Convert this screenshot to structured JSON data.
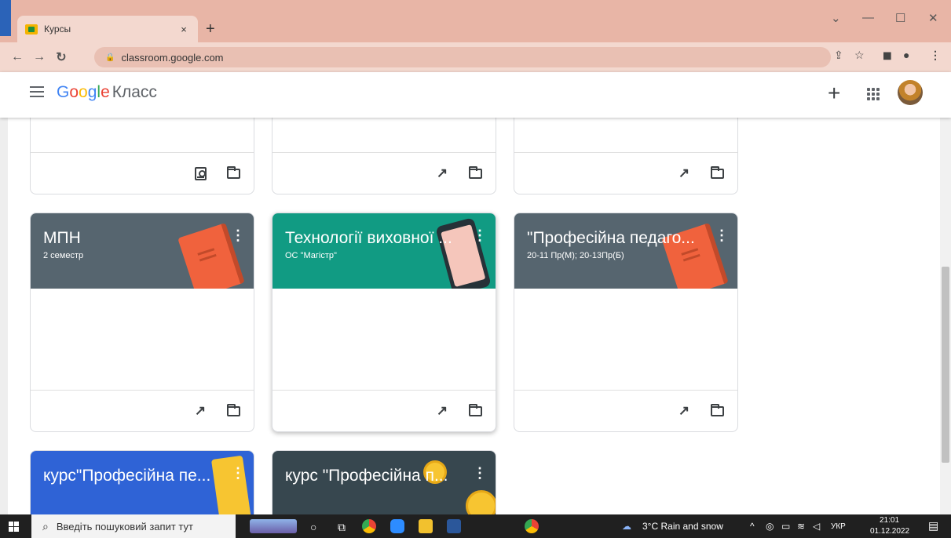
{
  "browser": {
    "tab_title": "Курсы",
    "tab_close": "×",
    "new_tab": "+",
    "url": "classroom.google.com",
    "window_controls": [
      "⌄",
      "—",
      "☐",
      "✕"
    ]
  },
  "app": {
    "logo_google": "Google",
    "logo_product": "Класс"
  },
  "cards": [
    {
      "name": "МПН",
      "section": "2 семестр",
      "color": "#56656f",
      "art": "book"
    },
    {
      "name": "Технології виховної ...",
      "section": "ОС \"Магістр\"",
      "color": "#119b83",
      "art": "phone"
    },
    {
      "name": "\"Професійна педаго...",
      "section": "20-11 Пр(М); 20-13Пр(Б)",
      "color": "#56656f",
      "art": "book"
    },
    {
      "name": "курс\"Професійна пе...",
      "section": "",
      "color": "#2f63d6",
      "art": "blue"
    },
    {
      "name": "курс \"Професійна п...",
      "section": "",
      "color": "#37474f",
      "art": "coin"
    }
  ],
  "taskbar": {
    "search_placeholder": "Введіть пошуковий запит тут",
    "weather": "3°C  Rain and snow",
    "lang": "УКР",
    "time": "21:01",
    "date": "01.12.2022"
  }
}
